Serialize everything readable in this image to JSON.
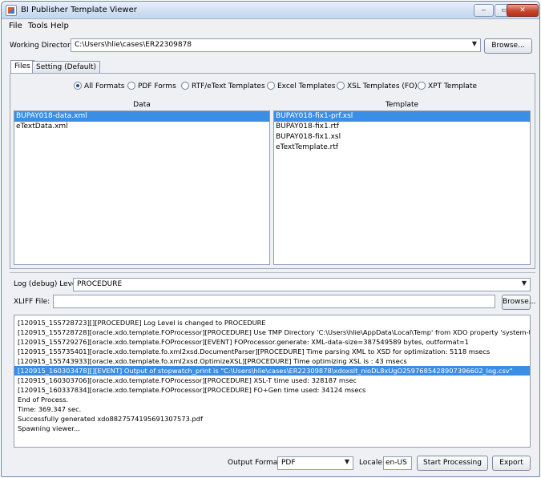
{
  "window": {
    "title": "BI Publisher Template Viewer",
    "minimize": "‒",
    "maximize": "▭",
    "close": "✕"
  },
  "menu": [
    "File",
    "Tools",
    "Help"
  ],
  "working_dir": {
    "label": "Working Directory:",
    "value": "C:\\Users\\hlie\\cases\\ER22309878",
    "browse": "Browse..."
  },
  "tabs": [
    "Files",
    "Setting (Default)"
  ],
  "formats": {
    "options": [
      "All Formats",
      "PDF Forms",
      "RTF/eText Templates",
      "Excel Templates",
      "XSL Templates (FO)",
      "XPT Template"
    ],
    "selected": "All Formats"
  },
  "data_list": {
    "header": "Data",
    "items": [
      "BUPAY018-data.xml",
      "eTextData.xml"
    ],
    "selected": "BUPAY018-data.xml"
  },
  "template_list": {
    "header": "Template",
    "items": [
      "BUPAY018-fix1-prf.xsl",
      "BUPAY018-fix1.rtf",
      "BUPAY018-fix1.xsl",
      "eTextTemplate.rtf"
    ],
    "selected": "BUPAY018-fix1-prf.xsl"
  },
  "log_level": {
    "label": "Log (debug) Level",
    "value": "PROCEDURE"
  },
  "xliff": {
    "label": "XLIFF File:",
    "value": "",
    "browse": "Browse..."
  },
  "log_lines": [
    "[120915_155728723][][PROCEDURE] Log Level is changed to PROCEDURE",
    "[120915_155728728][oracle.xdo.template.FOProcessor][PROCEDURE] Use TMP Directory 'C:\\Users\\hlie\\AppData\\Local\\Temp' from XDO property 'system-temp-dir'.",
    "[120915_155729276][oracle.xdo.template.FOProcessor][EVENT] FOProcessor.generate: XML-data-size=387549589 bytes, outformat=1",
    "[120915_155735401][oracle.xdo.template.fo.xml2xsd.DocumentParser][PROCEDURE] Time parsing XML to XSD for optimization: 5118 msecs",
    "[120915_155743933][oracle.xdo.template.fo.xml2xsd.OptimizeXSL][PROCEDURE] Time optimizing XSL is : 43 msecs",
    "[120915_160303478][][EVENT] Output of stopwatch_print is \"C:\\Users\\hlie\\cases\\ER22309878\\xdoxslt_nioDL8xUgO2597685428907396602_log.csv\"",
    "[120915_160303706][oracle.xdo.template.FOProcessor][PROCEDURE] XSL-T time used: 328187 msec",
    "[120915_160337834][oracle.xdo.template.FOProcessor][PROCEDURE] FO+Gen time used: 34124 msecs",
    "End of Process.",
    "Time: 369.347 sec.",
    "Successfully generated xdo8827574195691307573.pdf",
    "Spawning viewer..."
  ],
  "log_selected_index": 5,
  "bottom": {
    "output_format_label": "Output Format:",
    "output_format": "PDF",
    "locale_label": "Locale:",
    "locale": "en-US",
    "start": "Start Processing",
    "export": "Export"
  }
}
